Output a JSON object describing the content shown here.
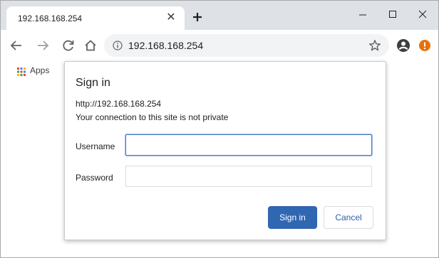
{
  "tab": {
    "title": "192.168.168.254",
    "close_icon": "close-icon"
  },
  "window_controls": [
    "minimize-icon",
    "maximize-icon",
    "close-icon"
  ],
  "toolbar": {
    "icons": [
      "back-arrow-icon",
      "forward-arrow-icon",
      "reload-icon",
      "home-icon",
      "info-icon",
      "star-icon",
      "profile-icon",
      "update-alert-icon"
    ],
    "address": "192.168.168.254"
  },
  "bookmarks": {
    "apps_label": "Apps"
  },
  "dialog": {
    "title": "Sign in",
    "url": "http://192.168.168.254",
    "message": "Your connection to this site is not private",
    "username_label": "Username",
    "username_value": "",
    "password_label": "Password",
    "password_value": "",
    "signin_label": "Sign in",
    "cancel_label": "Cancel"
  },
  "colors": {
    "accent": "#3067b3",
    "tabstrip": "#dee1e6",
    "omnibox": "#f1f3f4",
    "update_badge": "#e8710a"
  }
}
